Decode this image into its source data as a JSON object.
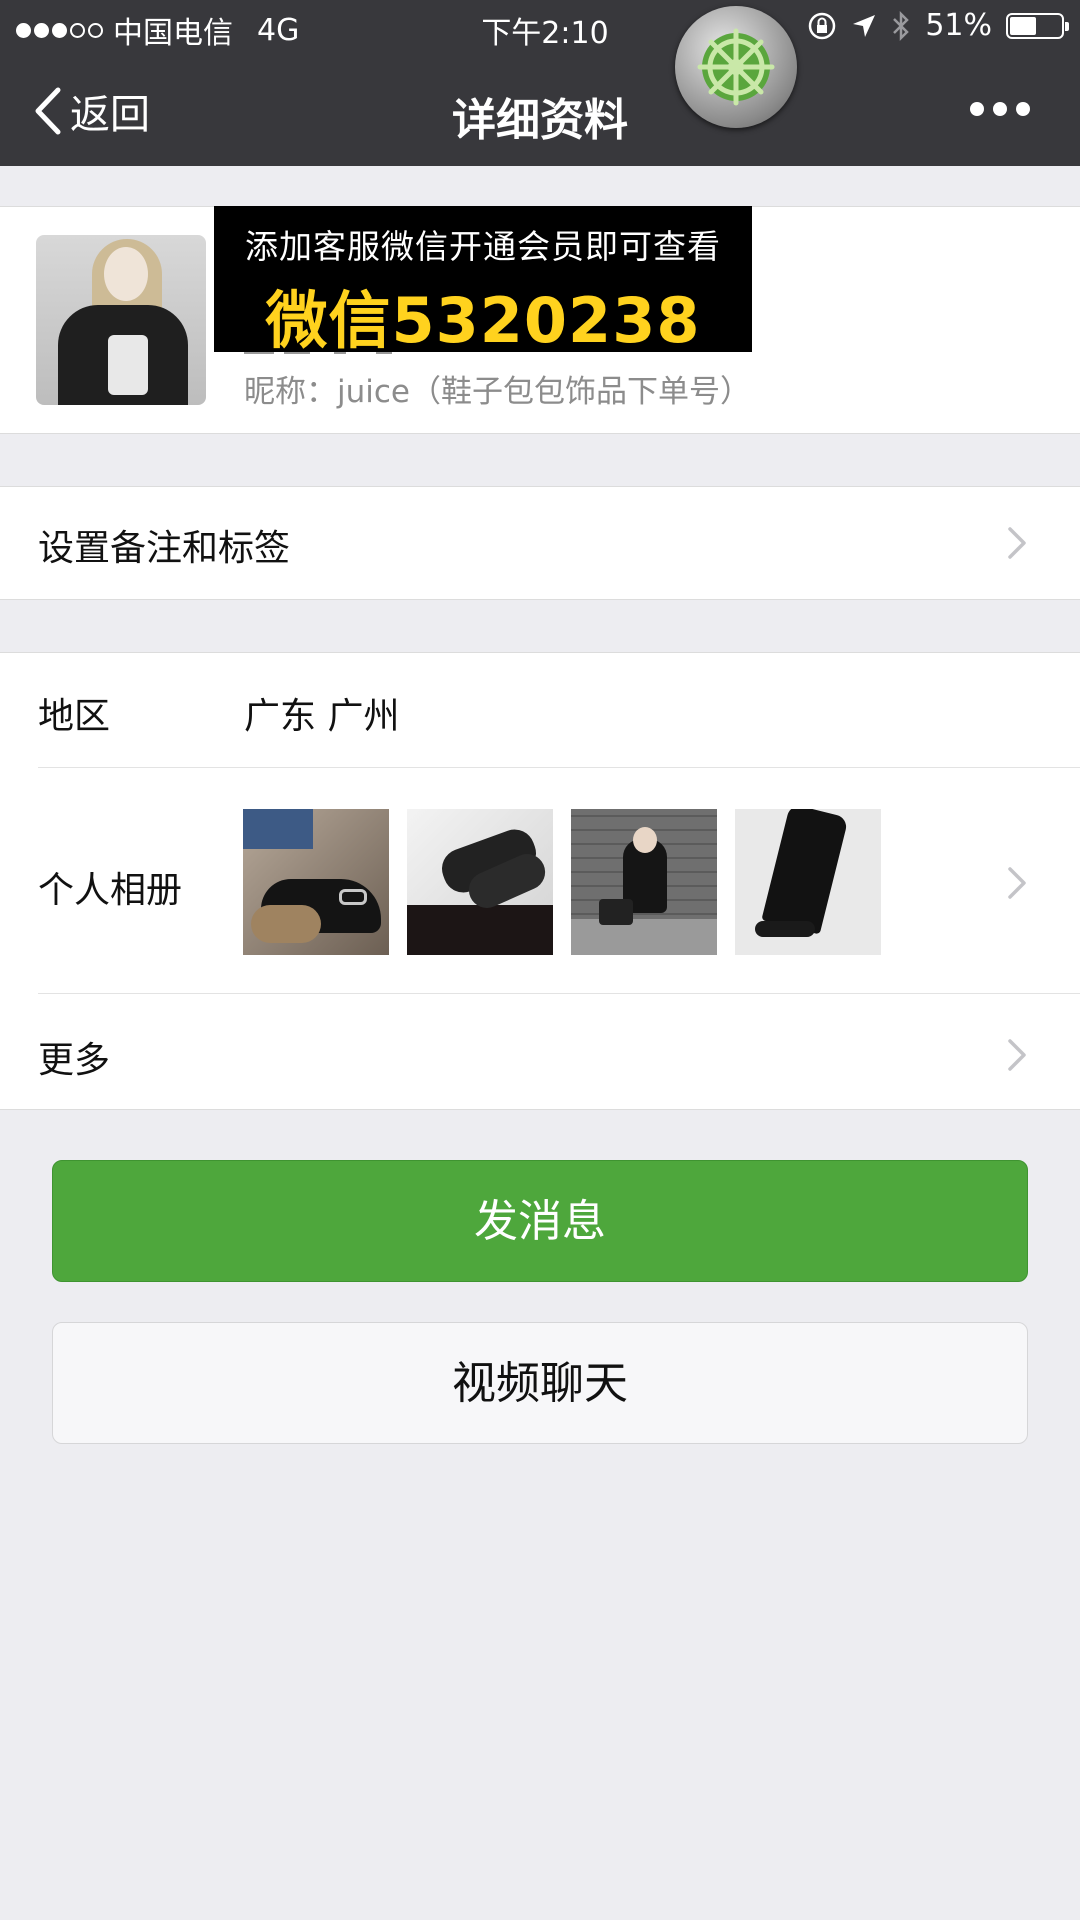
{
  "status_bar": {
    "carrier": "中国电信",
    "network": "4G",
    "time": "下午2:10",
    "battery": "51%",
    "battery_level": 0.51,
    "icons": [
      "signal-dots-icon",
      "orientation-lock-icon",
      "location-arrow-icon",
      "bluetooth-icon",
      "battery-icon"
    ]
  },
  "nav": {
    "back_label": "返回",
    "title": "详细资料",
    "more_icon": "more-dots-icon",
    "overlay_icon": "ship-helm-icon"
  },
  "profile": {
    "nickname": "昵称：juice（鞋子包包饰品下单号）"
  },
  "promo": {
    "line1": "添加客服微信开通会员即可查看",
    "line2": "微信5320238"
  },
  "cells": {
    "remark": {
      "label": "设置备注和标签"
    },
    "region": {
      "label": "地区",
      "value": "广东 广州"
    },
    "album": {
      "label": "个人相册"
    },
    "more": {
      "label": "更多"
    }
  },
  "buttons": {
    "message": "发消息",
    "video_call": "视频聊天"
  },
  "colors": {
    "nav_bg": "#38383c",
    "primary_green": "#4ea73c",
    "page_bg": "#ededf1",
    "promo_yellow": "#ffd21e"
  }
}
